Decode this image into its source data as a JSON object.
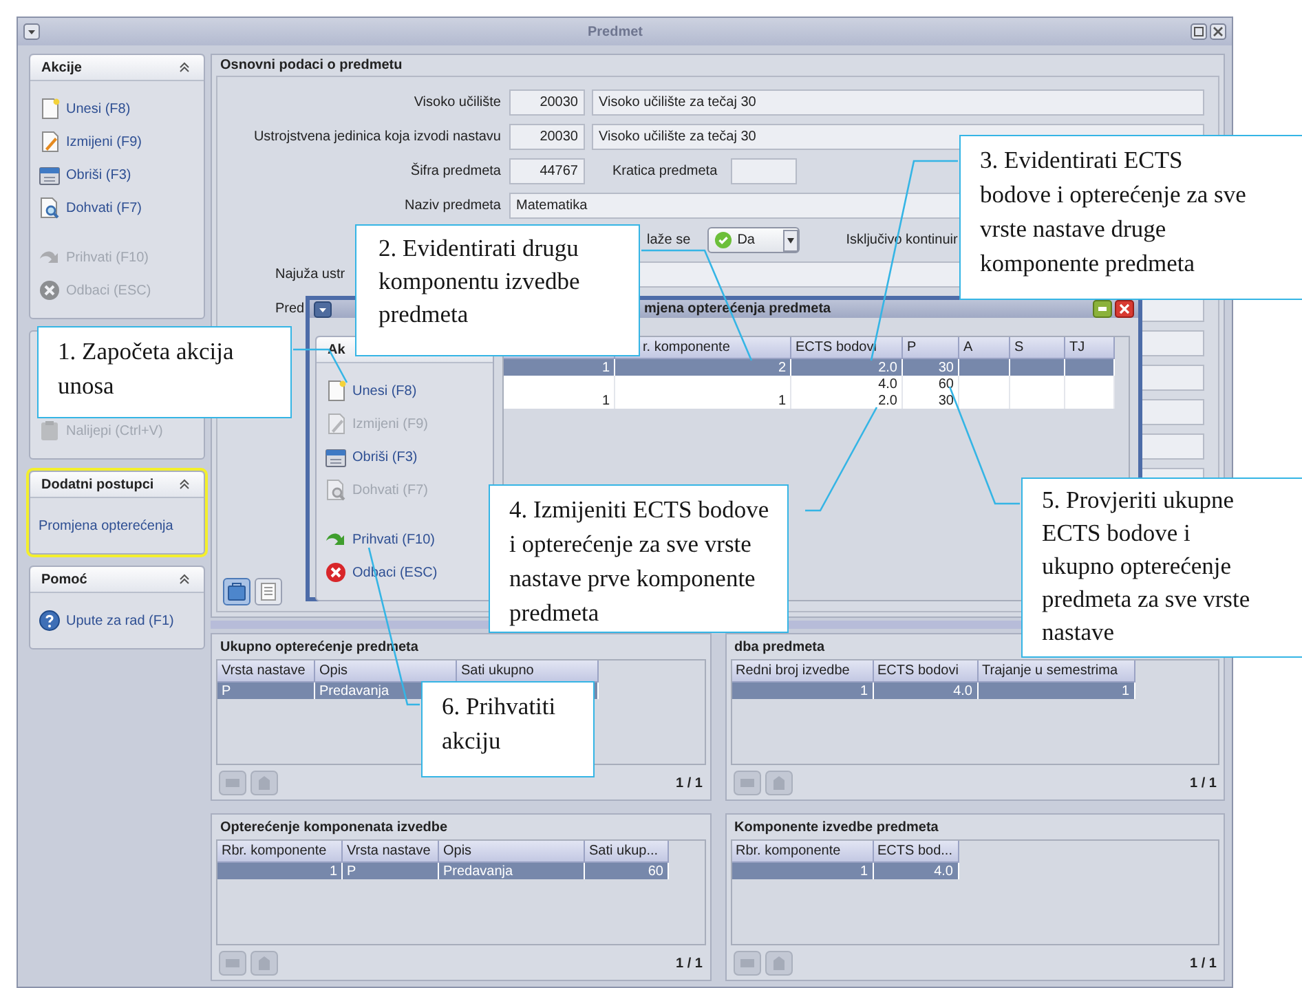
{
  "window": {
    "title": "Predmet"
  },
  "sidebar": [
    {
      "title": "Akcije",
      "highlighted": false,
      "items": [
        {
          "label": "Unesi (F8)",
          "kind": "new",
          "disabled": false
        },
        {
          "label": "Izmijeni (F9)",
          "kind": "edit",
          "disabled": false
        },
        {
          "label": "Obriši (F3)",
          "kind": "delete",
          "disabled": false
        },
        {
          "label": "Dohvati (F7)",
          "kind": "fetch",
          "disabled": false
        },
        {
          "label": "Prihvati (F10)",
          "kind": "accept",
          "disabled": true
        },
        {
          "label": "Odbaci (ESC)",
          "kind": "cancel",
          "disabled": true
        }
      ]
    },
    {
      "highlighted": false,
      "items": [
        {
          "label": "Nalijepi (Ctrl+V)",
          "kind": "paste",
          "disabled": true
        }
      ]
    },
    {
      "title": "Dodatni postupci",
      "highlighted": true,
      "items": [
        {
          "label": "Promjena opterećenja",
          "kind": "link",
          "disabled": false
        }
      ]
    },
    {
      "title": "Pomoć",
      "highlighted": false,
      "items": [
        {
          "label": "Upute za rad (F1)",
          "kind": "help",
          "disabled": false
        }
      ]
    }
  ],
  "form": {
    "title": "Osnovni podaci o predmetu",
    "rows": [
      {
        "kind": "code_name",
        "label": "Visoko učilište",
        "code": "20030",
        "name": "Visoko učilište za tečaj 30"
      },
      {
        "kind": "code_name",
        "label": "Ustrojstvena jedinica koja izvodi nastavu",
        "code": "20030",
        "name": "Visoko učilište za tečaj 30"
      },
      {
        "kind": "code_extra",
        "label": "Šifra predmeta",
        "code": "44767",
        "extra_label": "Kratica predmeta"
      },
      {
        "kind": "wide",
        "label": "Naziv predmeta",
        "value": "Matematika"
      },
      {
        "kind": "options",
        "label": "laže se",
        "choice": "Da",
        "note": "Isključivo kontinuir"
      },
      {
        "kind": "cut",
        "label": "Najuža ustr"
      },
      {
        "kind": "cut",
        "label": "Pred"
      },
      {
        "kind": "wide"
      },
      {
        "kind": "wide"
      },
      {
        "kind": "wide"
      },
      {
        "kind": "wide"
      },
      {
        "kind": "wide"
      }
    ],
    "views": [
      {
        "kind": "form",
        "selected": true
      },
      {
        "kind": "list",
        "selected": false
      }
    ]
  },
  "panels": [
    {
      "title": "Ukupno opterećenje predmeta",
      "columns": [
        {
          "label": "Vrsta nastave",
          "kind": "text"
        },
        {
          "label": "Opis",
          "kind": "text"
        },
        {
          "label": "Sati ukupno",
          "kind": "num"
        }
      ],
      "rows": [
        {
          "selected": true,
          "cells": [
            "P",
            "Predavanja",
            null
          ]
        }
      ],
      "pager": "1 / 1"
    },
    {
      "title": "dba predmeta",
      "columns": [
        {
          "label": "Redni broj izvedbe",
          "kind": "num"
        },
        {
          "label": "ECTS bodovi",
          "kind": "num"
        },
        {
          "label": "Trajanje u semestrima",
          "kind": "num"
        }
      ],
      "rows": [
        {
          "selected": true,
          "cells": [
            "1",
            "4.0",
            "1"
          ]
        }
      ],
      "pager": "1 / 1"
    },
    {
      "title": "Opterećenje komponenata izvedbe",
      "columns": [
        {
          "label": "Rbr. komponente",
          "kind": "num"
        },
        {
          "label": "Vrsta nastave",
          "kind": "text"
        },
        {
          "label": "Opis",
          "kind": "text"
        },
        {
          "label": "Sati ukup...",
          "kind": "num"
        }
      ],
      "rows": [
        {
          "selected": true,
          "cells": [
            "1",
            "P",
            "Predavanja",
            "60"
          ]
        }
      ],
      "pager": "1 / 1"
    },
    {
      "title": "Komponente izvedbe predmeta",
      "columns": [
        {
          "label": "Rbr. komponente",
          "kind": "num"
        },
        {
          "label": "ECTS bod...",
          "kind": "num"
        }
      ],
      "rows": [
        {
          "selected": true,
          "cells": [
            "1",
            "4.0"
          ]
        }
      ],
      "pager": "1 / 1"
    }
  ],
  "dialog": {
    "title": "mjena opterećenja predmeta",
    "actions_title": "Ak",
    "actions": [
      {
        "label": "Unesi (F8)",
        "kind": "new",
        "disabled": false
      },
      {
        "label": "Izmijeni (F9)",
        "kind": "edit",
        "disabled": true
      },
      {
        "label": "Obriši (F3)",
        "kind": "delete",
        "disabled": false
      },
      {
        "label": "Dohvati (F7)",
        "kind": "fetch",
        "disabled": true
      },
      {
        "label": "Prihvati (F10)",
        "kind": "accept",
        "disabled": false
      },
      {
        "label": "Odbaci (ESC)",
        "kind": "cancel",
        "disabled": false
      }
    ],
    "columns": [
      {
        "kind": "num"
      },
      {
        "label": "r. komponente",
        "kind": "num"
      },
      {
        "label": "ECTS bodovi",
        "kind": "num"
      },
      {
        "label": "P",
        "kind": "num"
      },
      {
        "label": "A",
        "kind": "num"
      },
      {
        "label": "S",
        "kind": "num"
      },
      {
        "label": "TJ",
        "kind": "num"
      }
    ],
    "rows": [
      {
        "selected": true,
        "cells": [
          "1",
          "2",
          "2.0",
          "30",
          null,
          null,
          null
        ]
      },
      {
        "selected": false,
        "cells": [
          null,
          null,
          "4.0",
          "60",
          null,
          null,
          null
        ]
      },
      {
        "selected": false,
        "cells": [
          "1",
          "1",
          "2.0",
          "30",
          null,
          null,
          null
        ]
      }
    ]
  },
  "callouts": [
    {
      "lines": [
        "1. Započeta akcija",
        "unosa"
      ]
    },
    {
      "lines": [
        "2. Evidentirati drugu",
        "komponentu izvedbe",
        "predmeta"
      ]
    },
    {
      "lines": [
        "3. Evidentirati ECTS",
        "bodove i opterećenje za sve",
        "vrste nastave druge",
        "komponente predmeta"
      ]
    },
    {
      "lines": [
        "4. Izmijeniti ECTS bodove",
        "i opterećenje za sve vrste",
        "nastave prve komponente",
        "predmeta"
      ]
    },
    {
      "lines": [
        "5. Provjeriti ukupne",
        "ECTS bodove i",
        "ukupno opterećenje",
        "predmeta za sve vrste",
        "nastave"
      ]
    },
    {
      "lines": [
        "6. Prihvatiti",
        "akciju"
      ]
    }
  ]
}
